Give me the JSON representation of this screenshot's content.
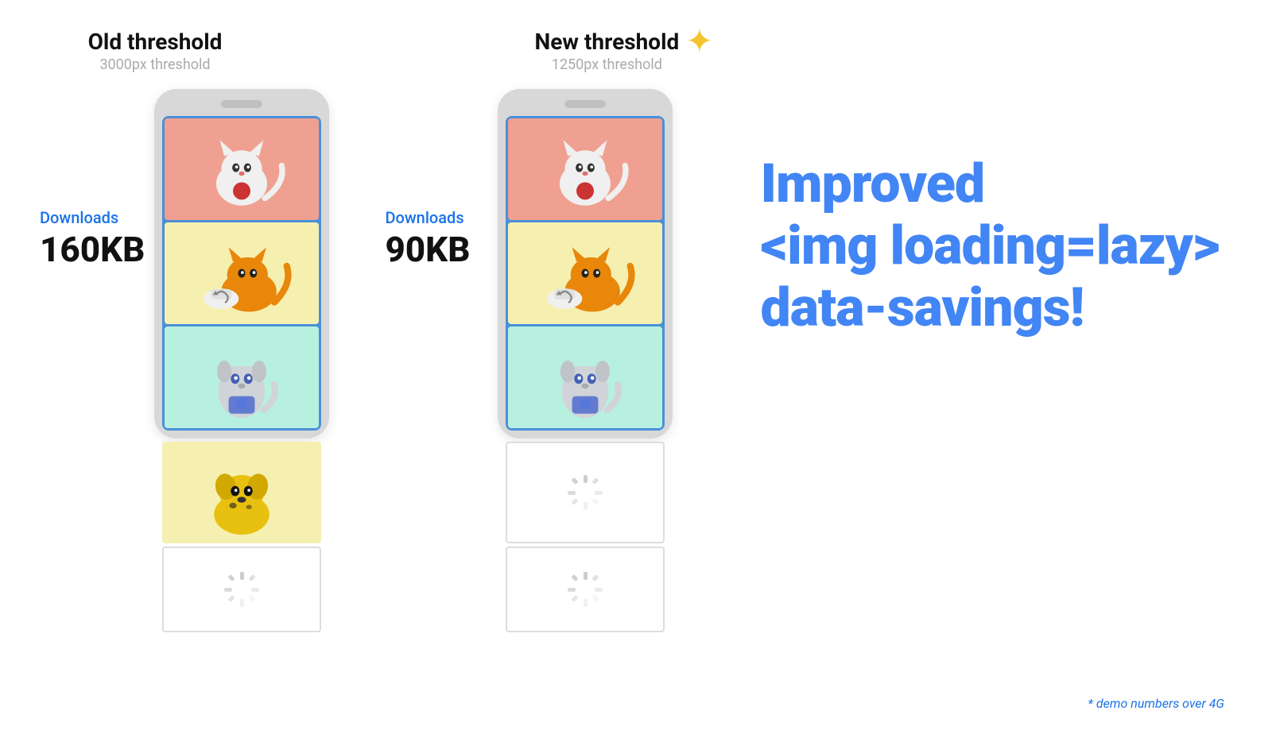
{
  "left": {
    "threshold_title": "Old threshold",
    "threshold_sub": "3000px threshold",
    "download_label": "Downloads",
    "download_size": "160KB"
  },
  "right": {
    "threshold_title": "New threshold",
    "threshold_sub": "1250px threshold",
    "download_label": "Downloads",
    "download_size": "90KB"
  },
  "headline": {
    "line1": "Improved",
    "line2": "<img loading=lazy>",
    "line3": "data-savings!"
  },
  "footer": {
    "note": "* demo numbers over 4G"
  },
  "colors": {
    "blue": "#4285f4",
    "dark": "#111111",
    "gray": "#999999",
    "link_blue": "#1a73e8"
  }
}
